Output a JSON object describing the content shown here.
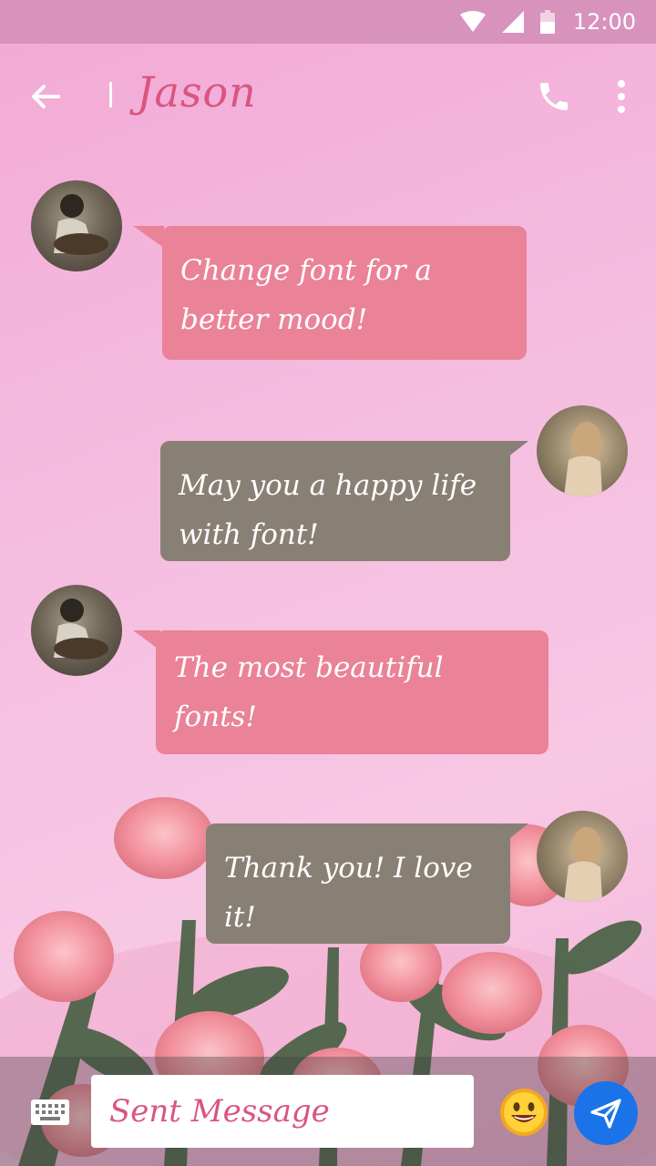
{
  "status_bar": {
    "time": "12:00",
    "wifi_icon": "wifi-icon",
    "signal_icon": "signal-icon",
    "battery_icon": "battery-icon"
  },
  "app_bar": {
    "title": "Jason",
    "back_icon": "arrow-back-icon",
    "call_icon": "phone-icon",
    "more_icon": "more-vert-icon"
  },
  "messages": [
    {
      "direction": "incoming",
      "text": "Change font for a better mood!"
    },
    {
      "direction": "outgoing",
      "text": "May you a happy life with font!"
    },
    {
      "direction": "incoming",
      "text": "The most beautiful fonts!"
    },
    {
      "direction": "outgoing",
      "text": "Thank you! I love it!"
    }
  ],
  "composer": {
    "placeholder": "Sent Message",
    "keyboard_icon": "keyboard-icon",
    "emoji_icon": "emoji-icon",
    "send_icon": "send-icon"
  },
  "colors": {
    "accent": "#d9557f",
    "incoming_bubble": "#ea8298",
    "outgoing_bubble": "#898075",
    "send_button": "#1a73e8"
  }
}
